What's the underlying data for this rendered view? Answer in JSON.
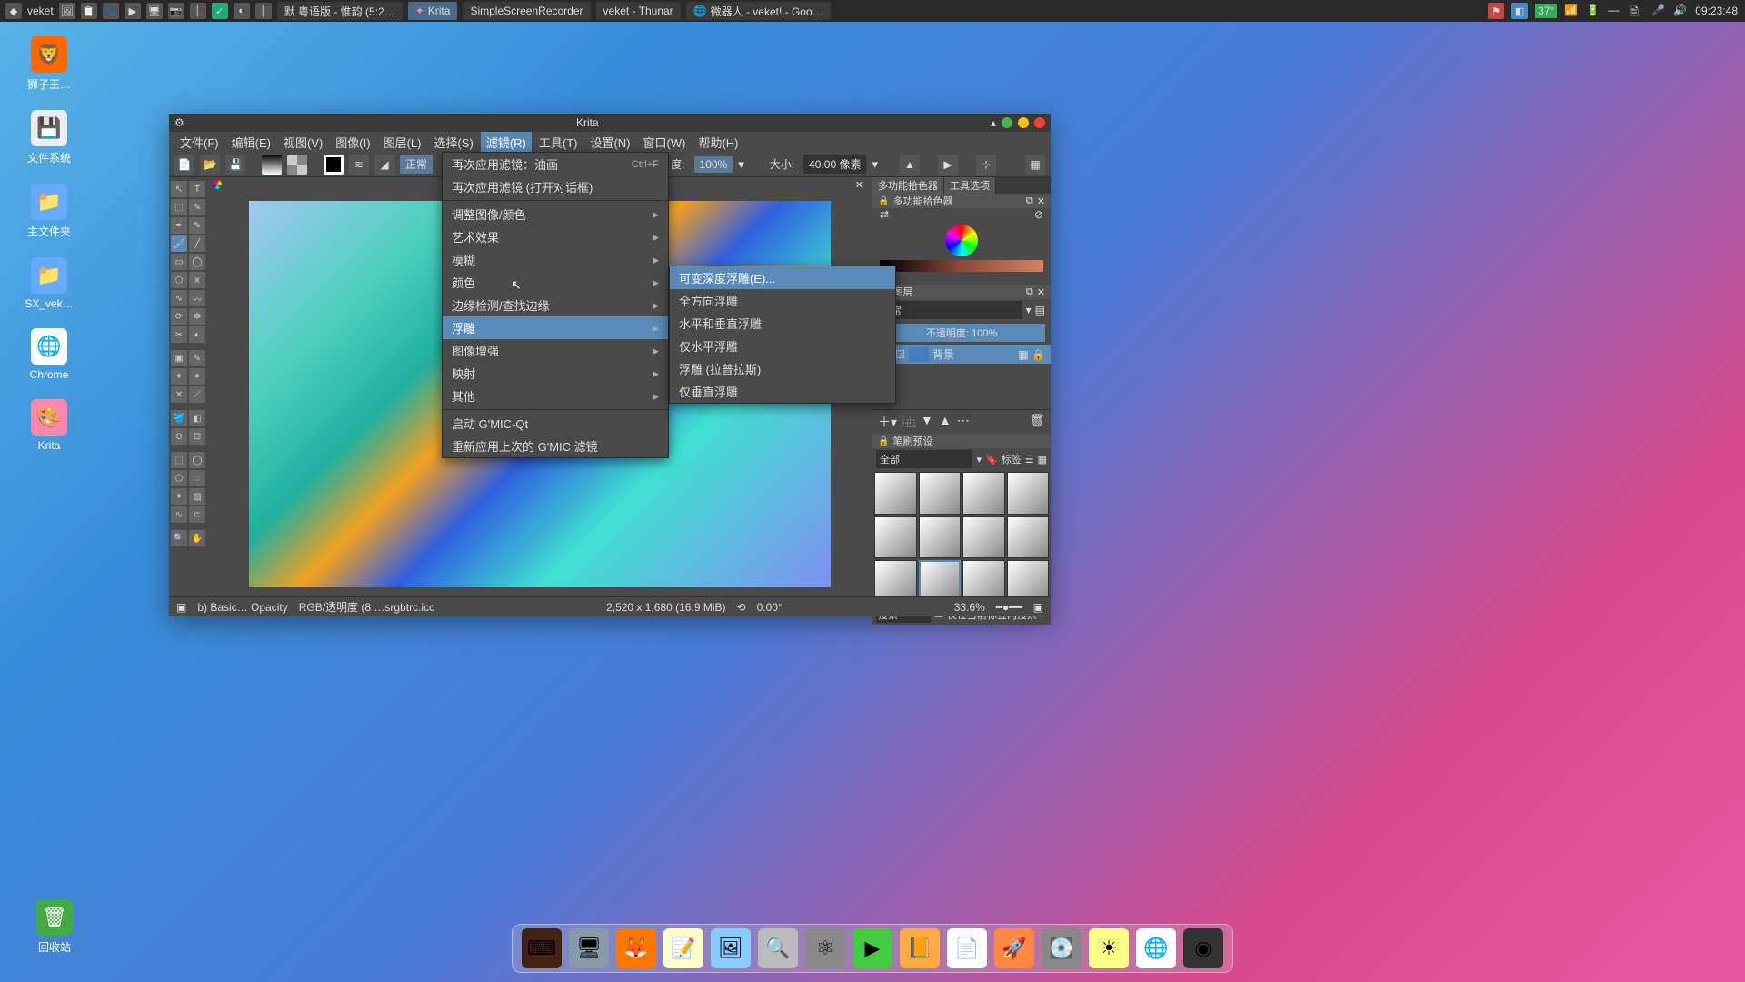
{
  "taskbar": {
    "app_label": "veket",
    "items": [
      {
        "label": "默 粤语版 - 惟韵 (5:2…"
      },
      {
        "label": "Krita",
        "active": true
      },
      {
        "label": "SimpleScreenRecorder"
      },
      {
        "label": "veket - Thunar"
      },
      {
        "label": "微器人 - veket! - Goo…"
      }
    ],
    "temp": "37°",
    "time": "09:23:48"
  },
  "desktop_icons": [
    {
      "label": "狮子王…",
      "glyph": "🦁"
    },
    {
      "label": "文件系统",
      "glyph": "💾"
    },
    {
      "label": "主文件夹",
      "glyph": "📁"
    },
    {
      "label": "SX_vek…",
      "glyph": "📁"
    },
    {
      "label": "Chrome",
      "glyph": "🌐"
    },
    {
      "label": "Krita",
      "glyph": "🎨"
    }
  ],
  "recycle_bin_label": "回收站",
  "krita": {
    "title": "Krita",
    "menubar": [
      "文件(F)",
      "编辑(E)",
      "视图(V)",
      "图像(I)",
      "图层(L)",
      "选择(S)",
      "滤镜(R)",
      "工具(T)",
      "设置(N)",
      "窗口(W)",
      "帮助(H)"
    ],
    "toolbar": {
      "mode": "正常",
      "opacity_label": "度:",
      "opacity_value": "100%",
      "size_label": "大小:",
      "size_value": "40.00 像素"
    },
    "filter_menu": {
      "items": [
        {
          "label": "再次应用滤镜：油画",
          "shortcut": "Ctrl+F"
        },
        {
          "label": "再次应用滤镜 (打开对话框)"
        },
        {
          "sep": true
        },
        {
          "label": "调整图像/颜色",
          "sub": true
        },
        {
          "label": "艺术效果",
          "sub": true
        },
        {
          "label": "模糊",
          "sub": true
        },
        {
          "label": "颜色",
          "sub": true
        },
        {
          "label": "边缘检测/查找边缘",
          "sub": true
        },
        {
          "label": "浮雕",
          "sub": true,
          "hover": true
        },
        {
          "label": "图像增强",
          "sub": true
        },
        {
          "label": "映射",
          "sub": true
        },
        {
          "label": "其他",
          "sub": true
        },
        {
          "sep": true
        },
        {
          "label": "启动 G'MIC-Qt"
        },
        {
          "label": "重新应用上次的 G'MIC 滤镜"
        }
      ]
    },
    "emboss_submenu": [
      "可变深度浮雕(E)...",
      "全方向浮雕",
      "水平和垂直浮雕",
      "仅水平浮雕",
      "浮雕 (拉普拉斯)",
      "仅垂直浮雕"
    ],
    "right_panels": {
      "tabs": [
        "多功能拾色器",
        "工具选项"
      ],
      "color_panel_title": "多功能拾色器",
      "layers_title": "图层",
      "layers_mode": "正常",
      "layers_opacity_label": "不透明度:",
      "layers_opacity_value": "100%",
      "layer_name": "背景",
      "brush_title": "笔刷预设",
      "brush_filter": "全部",
      "brush_tag_label": "标签",
      "search_placeholder": "搜索",
      "search_in_tag": "仅在当前标签内搜索"
    },
    "statusbar": {
      "brush": "b) Basic… Opacity",
      "colorspace": "RGB/透明度 (8 …srgbtrc.icc",
      "dimensions": "2,520 x 1,680 (16.9 MiB)",
      "rotation": "0.00°",
      "zoom": "33.6%"
    }
  }
}
